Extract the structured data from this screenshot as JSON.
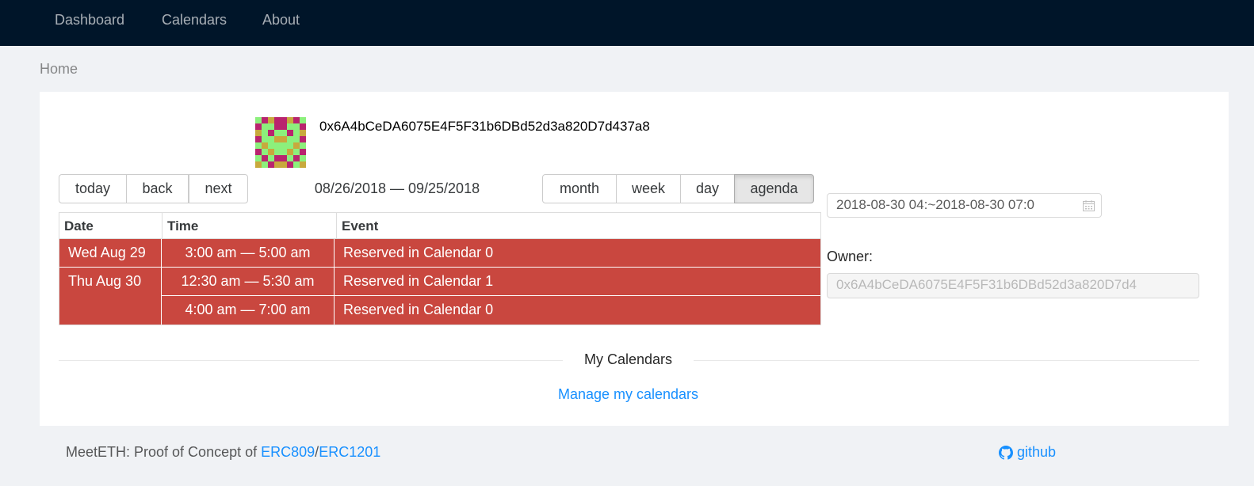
{
  "nav": {
    "items": [
      "Dashboard",
      "Calendars",
      "About"
    ]
  },
  "breadcrumb": "Home",
  "profile": {
    "address": "0x6A4bCeDA6075E4F5F31b6DBd52d3a820D7d437a8",
    "identicon_colors": {
      "primary": "#b9246e",
      "secondary": "#c8a93d",
      "background": "#8cf07c"
    }
  },
  "toolbar": {
    "nav_buttons": [
      "today",
      "back",
      "next"
    ],
    "range_label": "08/26/2018 — 09/25/2018",
    "view_buttons": [
      "month",
      "week",
      "day",
      "agenda"
    ],
    "active_view": "agenda"
  },
  "agenda": {
    "headers": {
      "date": "Date",
      "time": "Time",
      "event": "Event"
    },
    "event_color": "#c9473f",
    "dates": [
      "Wed Aug 29",
      "Thu Aug 30"
    ],
    "rows": [
      {
        "time": "3:00 am — 5:00 am",
        "event": "Reserved in Calendar 0"
      },
      {
        "time": "12:30 am — 5:30 am",
        "event": "Reserved in Calendar 1"
      },
      {
        "time": "4:00 am — 7:00 am",
        "event": "Reserved in Calendar 0"
      }
    ]
  },
  "side": {
    "range_value": "2018-08-30 04:~2018-08-30 07:0",
    "calendar_icon": "calendar-icon",
    "owner_label": "Owner:",
    "owner_value": "0x6A4bCeDA6075E4F5F31b6DBd52d3a820D7d4"
  },
  "section": {
    "divider": "My Calendars",
    "manage_link": "Manage my calendars"
  },
  "footer": {
    "text": "MeetETH: Proof of Concept of ",
    "link1": "ERC809",
    "sep": "/",
    "link2": "ERC1201",
    "github_icon": "github-icon",
    "github_label": "github"
  }
}
